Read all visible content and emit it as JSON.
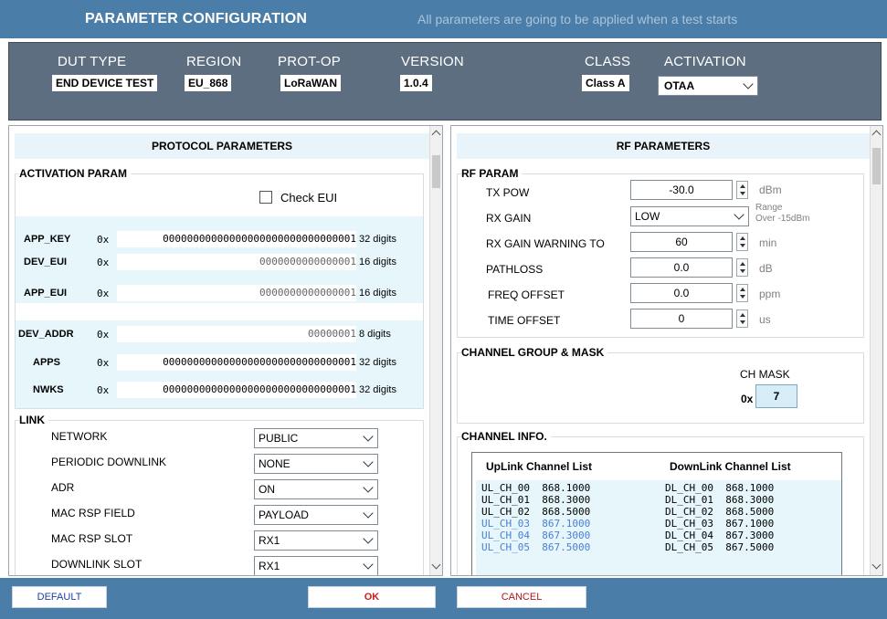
{
  "title": "PARAMETER CONFIGURATION",
  "subtitle": "All parameters are going to be applied when a test starts",
  "header": {
    "dut_type": {
      "label": "DUT TYPE",
      "value": "END DEVICE TEST"
    },
    "region": {
      "label": "REGION",
      "value": "EU_868"
    },
    "prot_op": {
      "label": "PROT-OP",
      "value": "LoRaWAN"
    },
    "version": {
      "label": "VERSION",
      "value": "1.0.4"
    },
    "class": {
      "label": "CLASS",
      "value": "Class A"
    },
    "activation": {
      "label": "ACTIVATION",
      "value": "OTAA"
    }
  },
  "protocol": {
    "title": "PROTOCOL PARAMETERS",
    "activation_title": "ACTIVATION PARAM",
    "check_eui": "Check EUI",
    "keys": [
      {
        "name": "APP_KEY",
        "prefix": "0x",
        "value": "00000000000000000000000000000001",
        "digits": "32 digits"
      },
      {
        "name": "DEV_EUI",
        "prefix": "0x",
        "value": "0000000000000001",
        "digits": "16 digits"
      },
      {
        "name": "APP_EUI",
        "prefix": "0x",
        "value": "0000000000000001",
        "digits": "16 digits"
      },
      {
        "name": "DEV_ADDR",
        "prefix": "0x",
        "value": "00000001",
        "digits": "8 digits"
      },
      {
        "name": "APPS",
        "prefix": "0x",
        "value": "00000000000000000000000000000001",
        "digits": "32 digits"
      },
      {
        "name": "NWKS",
        "prefix": "0x",
        "value": "00000000000000000000000000000001",
        "digits": "32 digits"
      }
    ],
    "link_title": "LINK",
    "link": [
      {
        "label": "NETWORK",
        "value": "PUBLIC"
      },
      {
        "label": "PERIODIC DOWNLINK",
        "value": "NONE"
      },
      {
        "label": "ADR",
        "value": "ON"
      },
      {
        "label": "MAC RSP FIELD",
        "value": "PAYLOAD"
      },
      {
        "label": "MAC RSP SLOT",
        "value": "RX1"
      },
      {
        "label": "DOWNLINK SLOT",
        "value": "RX1"
      }
    ]
  },
  "rf": {
    "title": "RF PARAMETERS",
    "rf_param_title": "RF PARAM",
    "tx_pow": {
      "label": "TX POW",
      "value": "-30.0",
      "unit": "dBm"
    },
    "rx_gain": {
      "label": "RX GAIN",
      "value": "LOW",
      "range": "Range",
      "range_note": "Over -15dBm"
    },
    "rx_gain_warning": {
      "label": "RX GAIN WARNING TO",
      "value": "60",
      "unit": "min"
    },
    "pathloss": {
      "label": "PATHLOSS",
      "value": "0.0",
      "unit": "dB"
    },
    "freq_offset": {
      "label": "FREQ OFFSET",
      "value": "0.0",
      "unit": "ppm"
    },
    "time_offset": {
      "label": "TIME OFFSET",
      "value": "0",
      "unit": "us"
    },
    "channel_group_title": "CHANNEL GROUP & MASK",
    "ch_mask_label": "CH MASK",
    "ch_mask_prefix": "0x",
    "ch_mask_value": "7",
    "channel_info_title": "CHANNEL INFO.",
    "uplink_header": "UpLink Channel List",
    "downlink_header": "DownLink Channel List",
    "uplink": [
      {
        "text": "UL_CH_00  868.1000",
        "color": "#000000"
      },
      {
        "text": "UL_CH_01  868.3000",
        "color": "#000000"
      },
      {
        "text": "UL_CH_02  868.5000",
        "color": "#000000"
      },
      {
        "text": "UL_CH_03  867.1000",
        "color": "#4a7fd6"
      },
      {
        "text": "UL_CH_04  867.3000",
        "color": "#4a7fd6"
      },
      {
        "text": "UL_CH_05  867.5000",
        "color": "#4a7fd6"
      }
    ],
    "downlink": [
      "DL_CH_00  868.1000",
      "DL_CH_01  868.3000",
      "DL_CH_02  868.5000",
      "DL_CH_03  867.1000",
      "DL_CH_04  867.3000",
      "DL_CH_05  867.5000"
    ]
  },
  "footer": {
    "default": "DEFAULT",
    "ok": "OK",
    "cancel": "CANCEL"
  },
  "colors": {
    "titlebar": "#4a7ea8",
    "header": "#5d6e80",
    "panel_head": "#e8f4fa",
    "ok_text": "#d21a1a",
    "default_text": "#1d3fa0"
  }
}
